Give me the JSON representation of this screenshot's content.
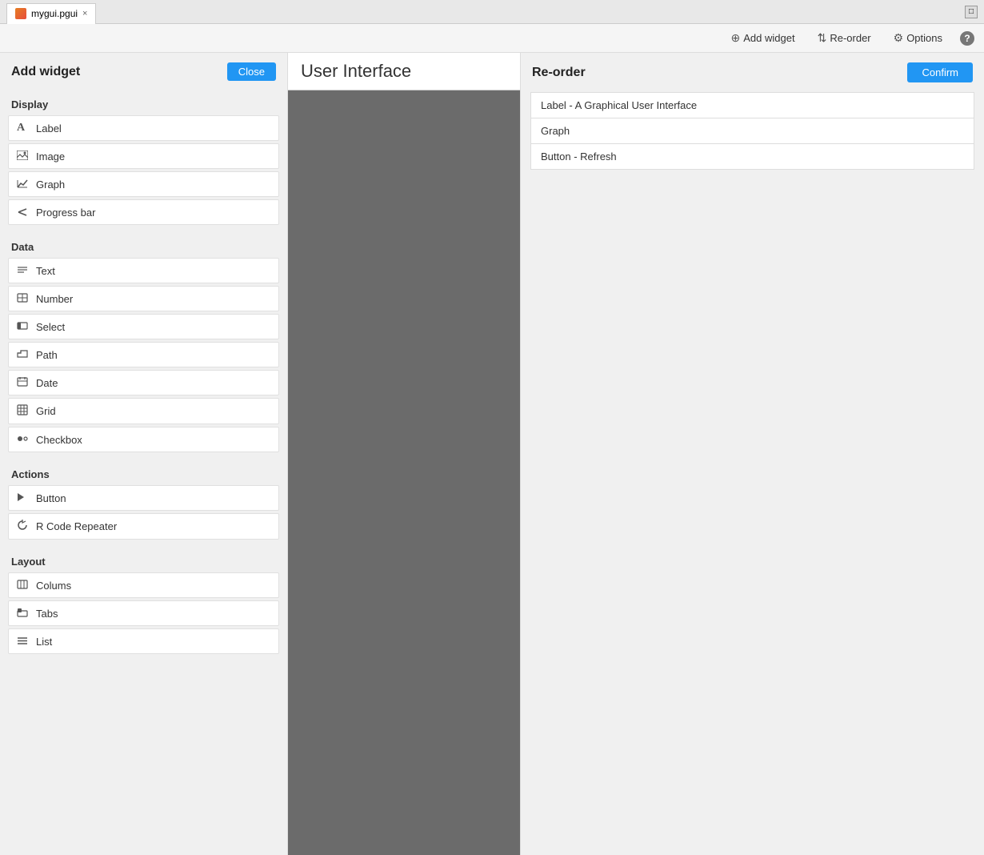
{
  "tabbar": {
    "tab_label": "mygui.pgui",
    "tab_close": "×"
  },
  "toolbar": {
    "add_widget_label": "Add widget",
    "reorder_label": "Re-order",
    "options_label": "Options",
    "help_label": "?",
    "add_icon": "⊕",
    "reorder_icon": "⇅",
    "options_icon": "⚙"
  },
  "left_panel": {
    "title": "Add widget",
    "close_label": "Close",
    "sections": [
      {
        "name": "Display",
        "items": [
          {
            "label": "Label",
            "icon": "A"
          },
          {
            "label": "Image",
            "icon": "🖼"
          },
          {
            "label": "Graph",
            "icon": "📈"
          },
          {
            "label": "Progress bar",
            "icon": "✕"
          }
        ]
      },
      {
        "name": "Data",
        "items": [
          {
            "label": "Text",
            "icon": "☰"
          },
          {
            "label": "Number",
            "icon": "▦"
          },
          {
            "label": "Select",
            "icon": "▣"
          },
          {
            "label": "Path",
            "icon": "📁"
          },
          {
            "label": "Date",
            "icon": "📅"
          },
          {
            "label": "Grid",
            "icon": "⊞"
          },
          {
            "label": "Checkbox",
            "icon": "⏺"
          }
        ]
      },
      {
        "name": "Actions",
        "items": [
          {
            "label": "Button",
            "icon": "▶"
          },
          {
            "label": "R Code Repeater",
            "icon": "↻"
          }
        ]
      },
      {
        "name": "Layout",
        "items": [
          {
            "label": "Colums",
            "icon": "⊟"
          },
          {
            "label": "Tabs",
            "icon": "◼"
          },
          {
            "label": "List",
            "icon": "☰"
          }
        ]
      }
    ]
  },
  "center_panel": {
    "title": "User Interface"
  },
  "right_panel": {
    "title": "Re-order",
    "confirm_label": "Confirm",
    "items": [
      "Label - A Graphical User Interface",
      "Graph",
      "Button - Refresh"
    ]
  }
}
